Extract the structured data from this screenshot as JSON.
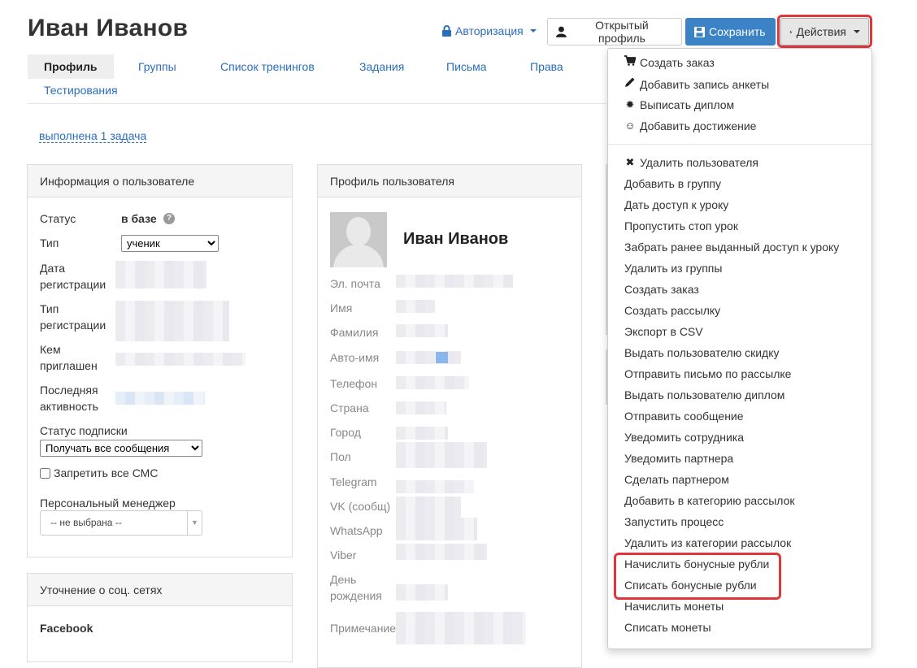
{
  "header": {
    "title": "Иван Иванов",
    "auth_label": "Авторизация",
    "open_profile_label": "Открытый профиль",
    "save_label": "Сохранить",
    "actions_label": "Действия"
  },
  "tabs": [
    {
      "label": "Профиль",
      "active": true
    },
    {
      "label": "Группы"
    },
    {
      "label": "Список тренингов"
    },
    {
      "label": "Задания"
    },
    {
      "label": "Письма"
    },
    {
      "label": "Права"
    },
    {
      "label": "Тестирования"
    }
  ],
  "task_link": "выполнена 1 задача",
  "user_info": {
    "heading": "Информация о пользователе",
    "status_label": "Статус",
    "status_value": "в базе",
    "type_label": "Тип",
    "type_value": "ученик",
    "reg_date_label_1": "Дата",
    "reg_date_label_2": "регистрации",
    "reg_type_label_1": "Тип",
    "reg_type_label_2": "регистрации",
    "invited_label_1": "Кем",
    "invited_label_2": "приглашен",
    "last_activity_label_1": "Последняя",
    "last_activity_label_2": "активность",
    "subscription_label": "Статус подписки",
    "subscription_value": "Получать все сообщения",
    "no_sms_label": "Запретить все СМС",
    "manager_label": "Персональный менеджер",
    "manager_value": "-- не выбрана --"
  },
  "social": {
    "heading": "Уточнение о соц. сетях",
    "facebook_label": "Facebook"
  },
  "profile": {
    "heading": "Профиль пользователя",
    "name": "Иван Иванов",
    "fields": [
      "Эл. почта",
      "Имя",
      "Фамилия",
      "Авто-имя",
      "Телефон",
      "Страна",
      "Город",
      "Пол",
      "Telegram",
      "VK (сообщ)",
      "WhatsApp",
      "Viber",
      "День",
      "рождения",
      "Примечание"
    ]
  },
  "actions_menu": {
    "top_items": [
      {
        "label": "Создать заказ",
        "icon": "cart-icon"
      },
      {
        "label": "Добавить запись анкеты",
        "icon": "pencil-icon"
      },
      {
        "label": "Выписать диплом",
        "icon": "certificate-icon"
      },
      {
        "label": "Добавить достижение",
        "icon": "smile-icon"
      }
    ],
    "items": [
      {
        "label": "Удалить пользователя",
        "icon": "remove-icon"
      },
      {
        "label": "Добавить в группу"
      },
      {
        "label": "Дать доступ к уроку"
      },
      {
        "label": "Пропустить стоп урок"
      },
      {
        "label": "Забрать ранее выданный доступ к уроку"
      },
      {
        "label": "Удалить из группы"
      },
      {
        "label": "Создать заказ"
      },
      {
        "label": "Создать рассылку"
      },
      {
        "label": "Экспорт в CSV"
      },
      {
        "label": "Выдать пользователю скидку"
      },
      {
        "label": "Отправить письмо по рассылке"
      },
      {
        "label": "Выдать пользователю диплом"
      },
      {
        "label": "Отправить сообщение"
      },
      {
        "label": "Уведомить сотрудника"
      },
      {
        "label": "Уведомить партнера"
      },
      {
        "label": "Сделать партнером"
      },
      {
        "label": "Добавить в категорию рассылок"
      },
      {
        "label": "Запустить процесс"
      },
      {
        "label": "Удалить из категории рассылок"
      },
      {
        "label": "Начислить бонусные рубли"
      },
      {
        "label": "Списать бонусные рубли"
      },
      {
        "label": "Начислить монеты"
      },
      {
        "label": "Списать монеты"
      }
    ]
  },
  "colors": {
    "link": "#2a6ebb",
    "primary_button": "#3c83c6",
    "highlight": "#e0353b"
  }
}
